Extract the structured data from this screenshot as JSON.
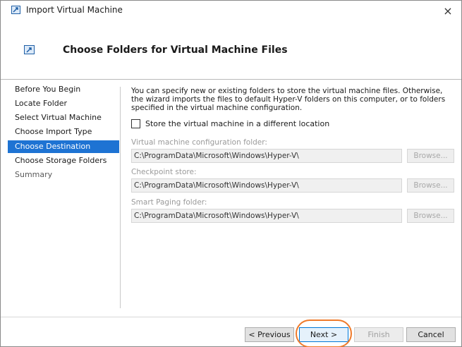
{
  "window": {
    "title": "Import Virtual Machine",
    "close_glyph": "×"
  },
  "banner": {
    "title": "Choose Folders for Virtual Machine Files"
  },
  "sidebar": {
    "items": [
      {
        "label": "Before You Begin",
        "state": "normal"
      },
      {
        "label": "Locate Folder",
        "state": "normal"
      },
      {
        "label": "Select Virtual Machine",
        "state": "normal"
      },
      {
        "label": "Choose Import Type",
        "state": "normal"
      },
      {
        "label": "Choose Destination",
        "state": "active"
      },
      {
        "label": "Choose Storage Folders",
        "state": "normal"
      },
      {
        "label": "Summary",
        "state": "muted"
      }
    ]
  },
  "content": {
    "description": "You can specify new or existing folders to store the virtual machine files. Otherwise, the wizard imports the files to default Hyper-V folders on this computer, or to folders specified in the virtual machine configuration.",
    "store_checkbox": {
      "label": "Store the virtual machine in a different location",
      "checked": false
    },
    "config_folder": {
      "label": "Virtual machine configuration folder:",
      "value": "C:\\ProgramData\\Microsoft\\Windows\\Hyper-V\\",
      "browse": "Browse..."
    },
    "checkpoint_store": {
      "label": "Checkpoint store:",
      "value": "C:\\ProgramData\\Microsoft\\Windows\\Hyper-V\\",
      "browse": "Browse..."
    },
    "smart_paging": {
      "label": "Smart Paging folder:",
      "value": "C:\\ProgramData\\Microsoft\\Windows\\Hyper-V\\",
      "browse": "Browse..."
    }
  },
  "footer": {
    "previous": "< Previous",
    "next": "Next >",
    "finish": "Finish",
    "cancel": "Cancel"
  },
  "colors": {
    "accent": "#1e73d3",
    "highlight_ring": "#ef7a2a"
  },
  "icons": {
    "app": "hyper-v-import-icon",
    "close": "close-icon"
  }
}
